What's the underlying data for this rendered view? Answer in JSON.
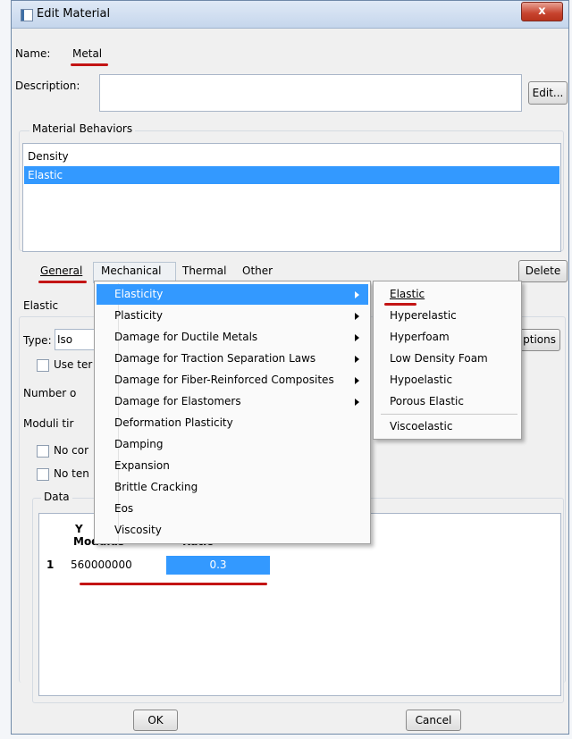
{
  "window": {
    "title": "Edit Material",
    "close_label": "x"
  },
  "name": {
    "label": "Name:",
    "value": "Metal"
  },
  "description": {
    "label": "Description:",
    "value": "",
    "edit_button": "Edit..."
  },
  "behaviors": {
    "group_label": "Material Behaviors",
    "items": [
      "Density",
      "Elastic"
    ],
    "selected": "Elastic"
  },
  "menubar": {
    "items": [
      "General",
      "Mechanical",
      "Thermal",
      "Other"
    ],
    "delete_button": "Delete"
  },
  "elastic_panel": {
    "title": "Elastic",
    "type_label": "Type:",
    "type_value": "Iso",
    "suboptions_button": "ptions",
    "use_temp_label": "Use ter",
    "number_label": "Number o",
    "moduli_label": "Moduli tir",
    "no_comp_label": "No cor",
    "no_tension_label": "No ten",
    "data_label": "Data"
  },
  "table": {
    "col1_line1": "Y",
    "col1_line2": "Modulus",
    "col2": "Ratio",
    "rows": [
      {
        "index": "1",
        "youngs_modulus": "560000000",
        "poissons_ratio": "0.3"
      }
    ]
  },
  "mechanical_menu": [
    {
      "label": "Elasticity",
      "submenu": true,
      "highlighted": true
    },
    {
      "label": "Plasticity",
      "submenu": true
    },
    {
      "label": "Damage for Ductile Metals",
      "submenu": true
    },
    {
      "label": "Damage for Traction Separation Laws",
      "submenu": true
    },
    {
      "label": "Damage for Fiber-Reinforced Composites",
      "submenu": true
    },
    {
      "label": "Damage for Elastomers",
      "submenu": true
    },
    {
      "label": "Deformation Plasticity",
      "submenu": false
    },
    {
      "label": "Damping",
      "submenu": false
    },
    {
      "label": "Expansion",
      "submenu": false
    },
    {
      "label": "Brittle Cracking",
      "submenu": false
    },
    {
      "label": "Eos",
      "submenu": false
    },
    {
      "label": "Viscosity",
      "submenu": false
    }
  ],
  "elasticity_submenu": [
    "Elastic",
    "Hyperelastic",
    "Hyperfoam",
    "Low Density Foam",
    "Hypoelastic",
    "Porous Elastic",
    "Viscoelastic"
  ],
  "buttons": {
    "ok": "OK",
    "cancel": "Cancel"
  },
  "colors": {
    "selection": "#3399ff",
    "annotation_red": "#c31414",
    "title_bar": "#c5d6ec"
  }
}
